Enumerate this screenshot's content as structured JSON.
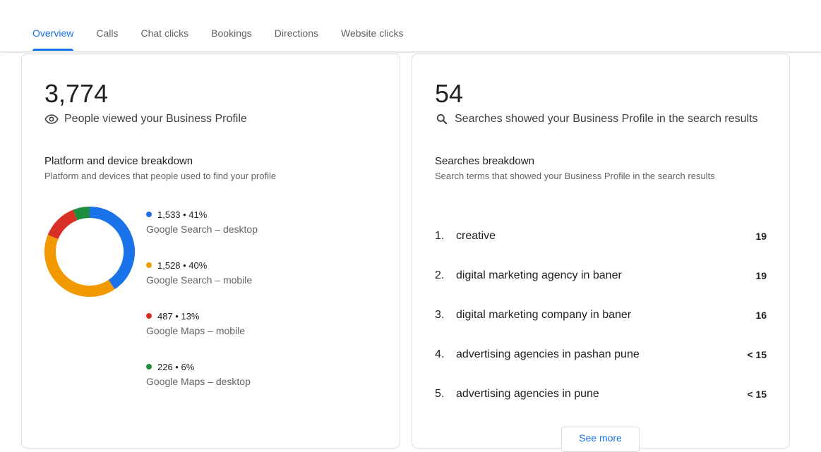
{
  "tabs": [
    {
      "label": "Overview",
      "active": true
    },
    {
      "label": "Calls"
    },
    {
      "label": "Chat clicks"
    },
    {
      "label": "Bookings"
    },
    {
      "label": "Directions"
    },
    {
      "label": "Website clicks"
    }
  ],
  "views_card": {
    "count": "3,774",
    "caption": "People viewed your Business Profile",
    "icon": "eye-icon",
    "breakdown_title": "Platform and device breakdown",
    "breakdown_subtitle": "Platform and devices that people used to find your profile",
    "legend": [
      {
        "summary": "1,533 • 41%",
        "label": "Google Search – desktop",
        "color": "#1a73e8"
      },
      {
        "summary": "1,528 • 40%",
        "label": "Google Search – mobile",
        "color": "#f29900"
      },
      {
        "summary": "487 • 13%",
        "label": "Google Maps – mobile",
        "color": "#d93025"
      },
      {
        "summary": "226 • 6%",
        "label": "Google Maps – desktop",
        "color": "#1e8e3e"
      }
    ]
  },
  "chart_data": {
    "type": "pie",
    "donut": true,
    "categories": [
      "Google Search – desktop",
      "Google Search – mobile",
      "Google Maps – mobile",
      "Google Maps – desktop"
    ],
    "values": [
      1533,
      1528,
      487,
      226
    ],
    "percentages": [
      41,
      40,
      13,
      6
    ],
    "colors": [
      "#1a73e8",
      "#f29900",
      "#d93025",
      "#1e8e3e"
    ]
  },
  "searches_card": {
    "count": "54",
    "caption": "Searches showed your Business Profile in the search results",
    "icon": "search-icon",
    "breakdown_title": "Searches breakdown",
    "breakdown_subtitle": "Search terms that showed your Business Profile in the search results",
    "rows": [
      {
        "rank": "1.",
        "term": "creative",
        "count": "19"
      },
      {
        "rank": "2.",
        "term": "digital marketing agency in baner",
        "count": "19"
      },
      {
        "rank": "3.",
        "term": "digital marketing company in baner",
        "count": "16"
      },
      {
        "rank": "4.",
        "term": "advertising agencies in pashan pune",
        "count": "< 15"
      },
      {
        "rank": "5.",
        "term": "advertising agencies in pune",
        "count": "< 15"
      }
    ],
    "see_more_label": "See more"
  }
}
